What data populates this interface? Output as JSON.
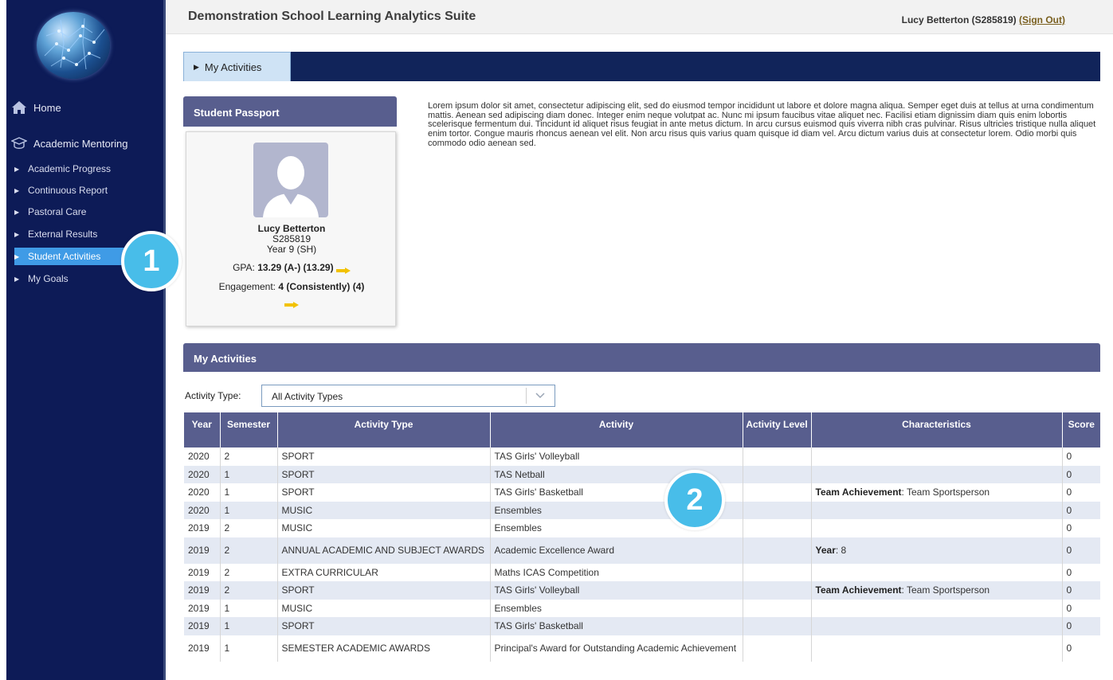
{
  "app": {
    "title": "Demonstration School Learning Analytics Suite",
    "user": "Lucy Betterton (S285819)",
    "sign_out": "(Sign Out)"
  },
  "sidebar": {
    "home": "Home",
    "academic_mentoring": "Academic Mentoring",
    "items": [
      {
        "label": "Academic Progress",
        "active": false
      },
      {
        "label": "Continuous Report",
        "active": false
      },
      {
        "label": "Pastoral Care",
        "active": false
      },
      {
        "label": "External Results",
        "active": false
      },
      {
        "label": "Student Activities",
        "active": true
      },
      {
        "label": "My Goals",
        "active": false
      }
    ]
  },
  "tab": {
    "label": "My Activities"
  },
  "passport": {
    "title": "Student Passport",
    "name": "Lucy Betterton",
    "student_id": "S285819",
    "year": "Year 9 (SH)",
    "gpa_label": "GPA:",
    "gpa_value": "13.29 (A-) (13.29)",
    "engagement_label": "Engagement:",
    "engagement_value": "4 (Consistently) (4)"
  },
  "intro_text": "Lorem ipsum dolor sit amet, consectetur adipiscing elit, sed do eiusmod tempor incididunt ut labore et dolore magna aliqua. Semper eget duis at tellus at urna condimentum mattis. Aenean sed adipiscing diam donec. Integer enim neque volutpat ac. Nunc mi ipsum faucibus vitae aliquet nec. Facilisi etiam dignissim diam quis enim lobortis scelerisque fermentum dui. Tincidunt id aliquet risus feugiat in ante metus dictum. In arcu cursus euismod quis viverra nibh cras pulvinar. Risus ultricies tristique nulla aliquet enim tortor. Congue mauris rhoncus aenean vel elit. Non arcu risus quis varius quam quisque id diam vel. Arcu dictum varius duis at consectetur lorem. Odio morbi quis commodo odio aenean sed.",
  "activities": {
    "title": "My Activities",
    "filter_label": "Activity Type:",
    "filter_value": "All Activity Types",
    "columns": [
      "Year",
      "Semester",
      "Activity Type",
      "Activity",
      "Activity Level",
      "Characteristics",
      "Score"
    ],
    "rows": [
      {
        "year": "2020",
        "semester": "2",
        "type": "SPORT",
        "activity": "TAS Girls' Volleyball",
        "level": "",
        "char_label": "",
        "char_value": "",
        "score": "0"
      },
      {
        "year": "2020",
        "semester": "1",
        "type": "SPORT",
        "activity": "TAS Netball",
        "level": "",
        "char_label": "",
        "char_value": "",
        "score": "0"
      },
      {
        "year": "2020",
        "semester": "1",
        "type": "SPORT",
        "activity": "TAS Girls' Basketball",
        "level": "",
        "char_label": "Team Achievement",
        "char_value": ": Team Sportsperson",
        "score": "0"
      },
      {
        "year": "2020",
        "semester": "1",
        "type": "MUSIC",
        "activity": "Ensembles",
        "level": "",
        "char_label": "",
        "char_value": "",
        "score": "0"
      },
      {
        "year": "2019",
        "semester": "2",
        "type": "MUSIC",
        "activity": "Ensembles",
        "level": "",
        "char_label": "",
        "char_value": "",
        "score": "0"
      },
      {
        "year": "2019",
        "semester": "2",
        "type": "ANNUAL ACADEMIC AND SUBJECT AWARDS",
        "activity": "Academic Excellence Award",
        "level": "",
        "char_label": "Year",
        "char_value": ": 8",
        "score": "0"
      },
      {
        "year": "2019",
        "semester": "2",
        "type": "EXTRA CURRICULAR",
        "activity": "Maths ICAS Competition",
        "level": "",
        "char_label": "",
        "char_value": "",
        "score": "0"
      },
      {
        "year": "2019",
        "semester": "2",
        "type": "SPORT",
        "activity": "TAS Girls' Volleyball",
        "level": "",
        "char_label": "Team Achievement",
        "char_value": ": Team Sportsperson",
        "score": "0"
      },
      {
        "year": "2019",
        "semester": "1",
        "type": "MUSIC",
        "activity": "Ensembles",
        "level": "",
        "char_label": "",
        "char_value": "",
        "score": "0"
      },
      {
        "year": "2019",
        "semester": "1",
        "type": "SPORT",
        "activity": "TAS Girls' Basketball",
        "level": "",
        "char_label": "",
        "char_value": "",
        "score": "0"
      },
      {
        "year": "2019",
        "semester": "1",
        "type": "SEMESTER ACADEMIC AWARDS",
        "activity": "Principal's Award for Outstanding Academic Achievement",
        "level": "",
        "char_label": "",
        "char_value": "",
        "score": "0"
      }
    ]
  },
  "callouts": [
    "1",
    "2"
  ],
  "colors": {
    "sidebar_bg": "#0d1b57",
    "active_item": "#3f9be6",
    "panel_header": "#585e8e",
    "tab_bar": "#11245a",
    "callout": "#48bde9",
    "arrow": "#f2c200"
  },
  "icons": [
    "school-logo-icon",
    "home-icon",
    "graduation-cap-icon",
    "triangle-right-icon",
    "avatar-placeholder-icon",
    "arrow-right-icon",
    "chevron-down-icon"
  ]
}
